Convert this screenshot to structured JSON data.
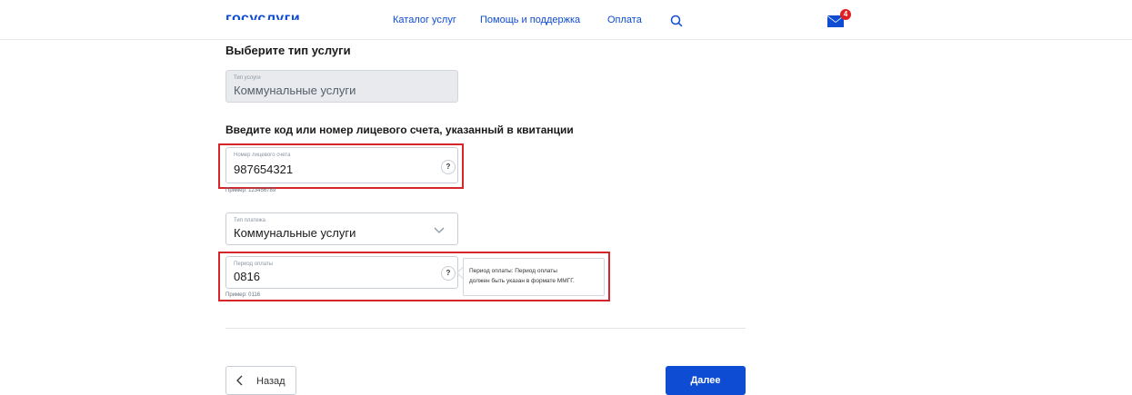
{
  "header": {
    "logo_text": "госуслуги",
    "nav": [
      {
        "label": "Каталог услуг"
      },
      {
        "label": "Помощь и поддержка"
      },
      {
        "label": "Оплата"
      }
    ],
    "mail_badge_count": "4"
  },
  "form": {
    "service_type_heading": "Выберите тип услуги",
    "service_type": {
      "label": "Тип услуги",
      "value": "Коммунальные услуги"
    },
    "code_heading": "Введите код или номер лицевого счета, указанный в квитанции",
    "account": {
      "label": "Номер лицевого счета",
      "value": "987654321",
      "hint": "Пример: 123456789",
      "help": "?"
    },
    "payment_type": {
      "label": "Тип платежа",
      "value": "Коммунальные услуги"
    },
    "period": {
      "label": "Период оплаты",
      "value": "0816",
      "hint": "Пример: 0116",
      "help": "?"
    },
    "tooltip": {
      "line1": "Период оплаты: Период оплаты",
      "line2": "должен быть указан в формате ММГГ."
    }
  },
  "footer": {
    "back_label": "Назад",
    "next_label": "Далее"
  },
  "colors": {
    "accent": "#0d4cd3",
    "highlight_border": "#d6262b",
    "badge": "#e02020"
  }
}
